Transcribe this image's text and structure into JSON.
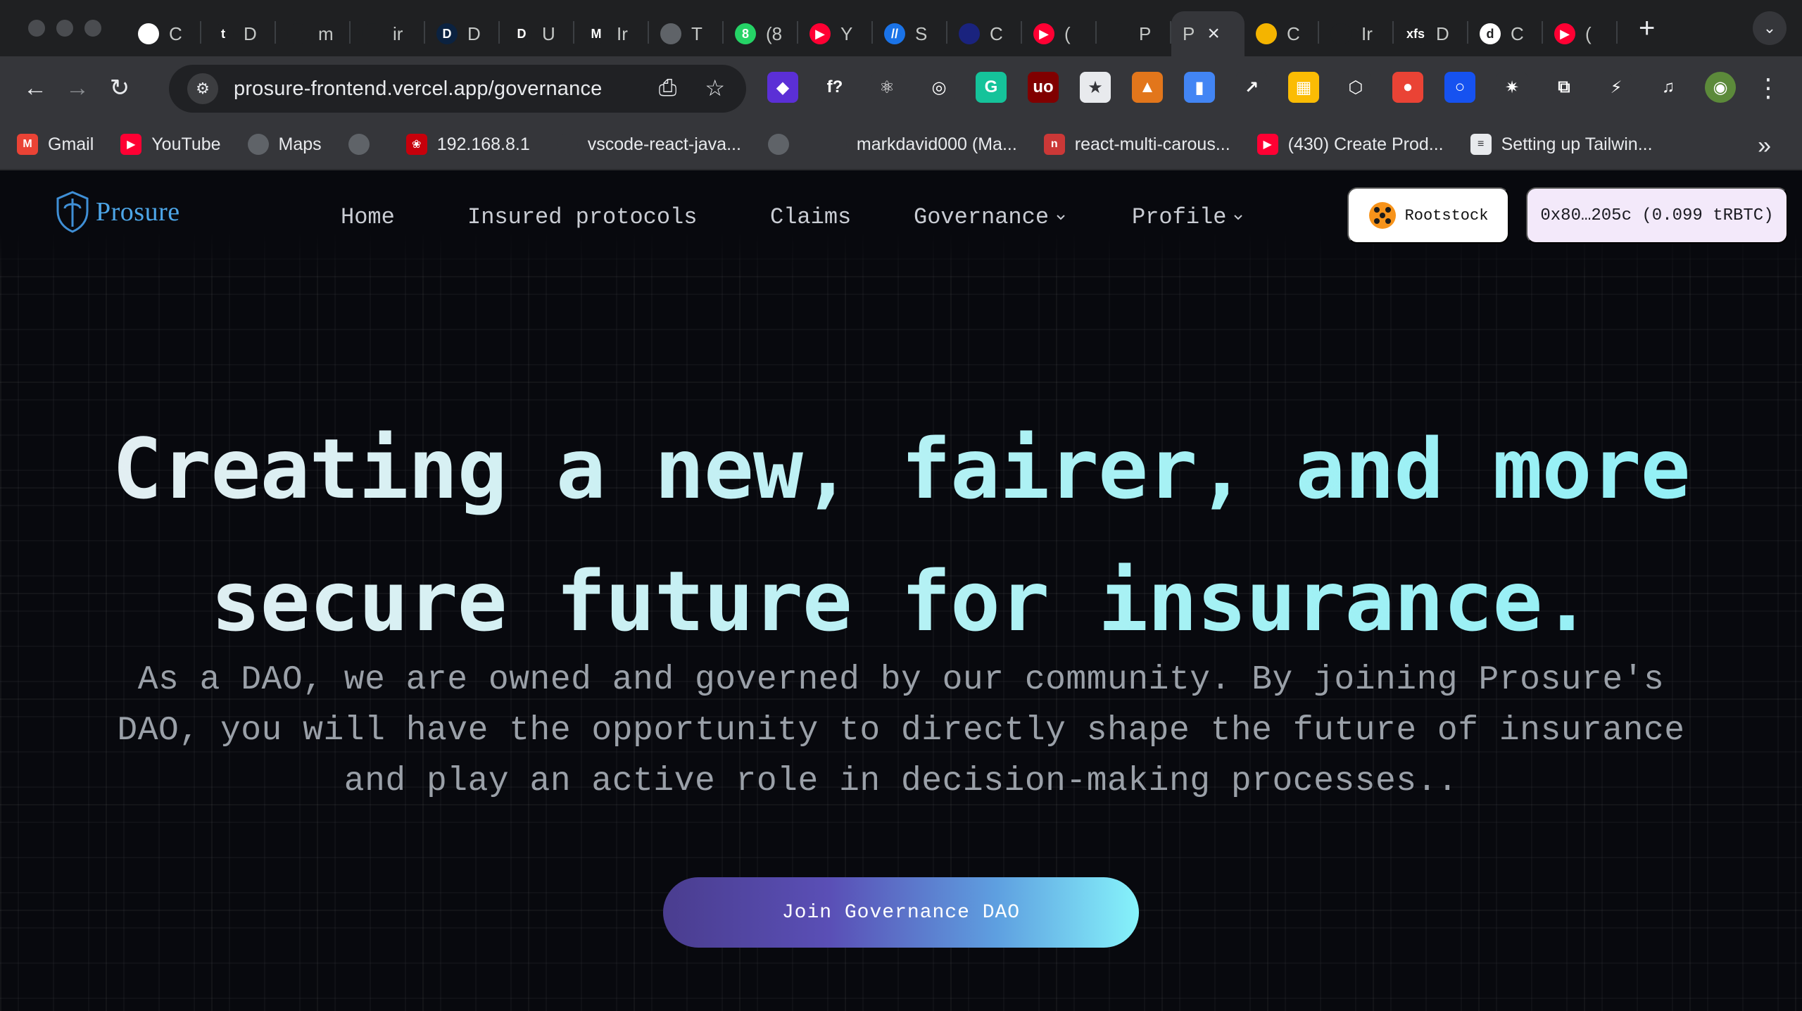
{
  "browser": {
    "tabs": [
      {
        "letter": "C",
        "fav_color": "#ffffff",
        "fav_text": "",
        "icon": "openai-icon"
      },
      {
        "letter": "D",
        "fav_color": "#1f2022",
        "fav_text": "t",
        "icon": "t-icon"
      },
      {
        "letter": "m",
        "fav_color": "#1f2022",
        "fav_text": "",
        "icon": "github-icon"
      },
      {
        "letter": "ir",
        "fav_color": "#1f2022",
        "fav_text": "",
        "icon": "github-icon"
      },
      {
        "letter": "D",
        "fav_color": "#0b2240",
        "fav_text": "D",
        "icon": "d-icon"
      },
      {
        "letter": "U",
        "fav_color": "#1f2022",
        "fav_text": "D",
        "icon": "d-circle-icon"
      },
      {
        "letter": "Ir",
        "fav_color": "#1f2022",
        "fav_text": "M",
        "icon": "gmail-icon"
      },
      {
        "letter": "T",
        "fav_color": "#5f6368",
        "fav_text": "",
        "icon": "globe-icon"
      },
      {
        "letter": "(8",
        "fav_color": "#25d366",
        "fav_text": "8",
        "icon": "whatsapp-icon"
      },
      {
        "letter": "Y",
        "fav_color": "#ff0033",
        "fav_text": "▶",
        "icon": "youtube-icon"
      },
      {
        "letter": "S",
        "fav_color": "#1a73e8",
        "fav_text": "//",
        "icon": "s-icon"
      },
      {
        "letter": "C",
        "fav_color": "#1a237e",
        "fav_text": "",
        "icon": "circle-icon"
      },
      {
        "letter": "(",
        "fav_color": "#ff0033",
        "fav_text": "▶",
        "icon": "youtube-icon"
      },
      {
        "letter": "P",
        "fav_color": "#1f2022",
        "fav_text": "",
        "icon": "prosure-shield-icon"
      }
    ],
    "active_tab": {
      "letter": "P"
    },
    "tabs_after": [
      {
        "letter": "C",
        "fav_color": "#f4b400",
        "fav_text": "",
        "icon": "slides-icon"
      },
      {
        "letter": "Ir",
        "fav_color": "#1f2022",
        "fav_text": "",
        "icon": "figma-icon"
      },
      {
        "letter": "D",
        "fav_color": "#1f2022",
        "fav_text": "xfs",
        "icon": "xfs-icon"
      },
      {
        "letter": "C",
        "fav_color": "#ffffff",
        "fav_text": "d",
        "icon": "d-square-icon"
      },
      {
        "letter": "(",
        "fav_color": "#ff0033",
        "fav_text": "▶",
        "icon": "youtube-icon"
      }
    ],
    "url": "prosure-frontend.vercel.app/governance",
    "extensions": [
      {
        "icon": "layers-ext-icon",
        "color": "#5b2fd6",
        "text": "◆"
      },
      {
        "icon": "fx-ext-icon",
        "color": "#35363a",
        "text": "f?"
      },
      {
        "icon": "react-ext-icon",
        "color": "#35363a",
        "text": "⚛"
      },
      {
        "icon": "target-ext-icon",
        "color": "#35363a",
        "text": "◎"
      },
      {
        "icon": "grammarly-ext-icon",
        "color": "#15c39a",
        "text": "G"
      },
      {
        "icon": "ublock-ext-icon",
        "color": "#800000",
        "text": "uo"
      },
      {
        "icon": "star-ext-icon",
        "color": "#e8eaed",
        "text": "★"
      },
      {
        "icon": "metamask-ext-icon",
        "color": "#e2761b",
        "text": "▲"
      },
      {
        "icon": "files-ext-icon",
        "color": "#4285f4",
        "text": "▮"
      },
      {
        "icon": "chart-ext-icon",
        "color": "#35363a",
        "text": "↗"
      },
      {
        "icon": "tiles-ext-icon",
        "color": "#fbbc04",
        "text": "▦"
      },
      {
        "icon": "cube-ext-icon",
        "color": "#35363a",
        "text": "⬡"
      },
      {
        "icon": "color-ext-icon",
        "color": "#ea4335",
        "text": "●"
      },
      {
        "icon": "coinbase-ext-icon",
        "color": "#1652f0",
        "text": "○"
      },
      {
        "icon": "spark-ext-icon",
        "color": "#35363a",
        "text": "✷"
      },
      {
        "icon": "puzzle-ext-icon",
        "color": "#35363a",
        "text": "⧉"
      },
      {
        "icon": "speed-ext-icon",
        "color": "#35363a",
        "text": "⚡"
      },
      {
        "icon": "media-ext-icon",
        "color": "#35363a",
        "text": "♫"
      },
      {
        "icon": "profile-avatar-icon",
        "color": "#5c8a3a",
        "text": "◉"
      }
    ],
    "bookmarks": [
      {
        "label": "Gmail",
        "icon": "gmail-icon",
        "color": "#ea4335",
        "text": "M"
      },
      {
        "label": "YouTube",
        "icon": "youtube-icon",
        "color": "#ff0033",
        "text": "▶"
      },
      {
        "label": "Maps",
        "icon": "globe-icon",
        "color": "#5f6368",
        "text": ""
      },
      {
        "label": "",
        "icon": "globe-icon",
        "color": "#5f6368",
        "text": ""
      },
      {
        "label": "192.168.8.1",
        "icon": "huawei-icon",
        "color": "#c7000b",
        "text": "❀"
      },
      {
        "label": "vscode-react-java...",
        "icon": "github-icon",
        "color": "#35363a",
        "text": ""
      },
      {
        "label": "",
        "icon": "globe-icon",
        "color": "#5f6368",
        "text": ""
      },
      {
        "label": "markdavid000 (Ma...",
        "icon": "github-icon",
        "color": "#35363a",
        "text": ""
      },
      {
        "label": "react-multi-carous...",
        "icon": "npm-icon",
        "color": "#cb3837",
        "text": "n"
      },
      {
        "label": "(430) Create Prod...",
        "icon": "youtube-icon",
        "color": "#ff0033",
        "text": "▶"
      },
      {
        "label": "Setting up Tailwin...",
        "icon": "doc-icon",
        "color": "#e8eaed",
        "text": "≡"
      }
    ]
  },
  "site": {
    "logo_text": "Prosure",
    "nav": {
      "home": "Home",
      "insured": "Insured protocols",
      "claims": "Claims",
      "governance": "Governance",
      "profile": "Profile"
    },
    "network_label": "Rootstock",
    "wallet_label": "0x80…205c (0.099 tRBTC)",
    "hero": {
      "line1": "Creating a new, fairer, and more",
      "line2": "secure future for insurance.",
      "subtitle": "As a DAO, we are owned and governed by our community. By joining Prosure's DAO, you will have the opportunity to directly shape the future of insurance and play an active role in decision-making processes..",
      "cta": "Join Governance DAO"
    }
  }
}
